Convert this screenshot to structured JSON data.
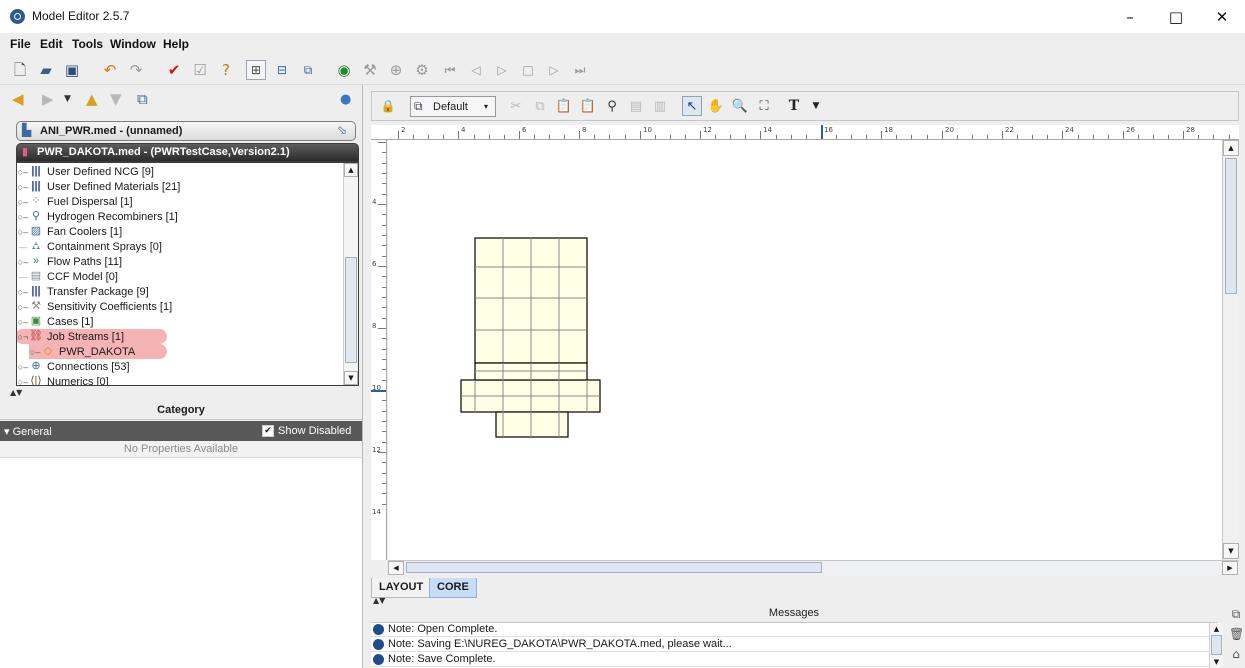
{
  "window": {
    "title": "Model Editor 2.5.7",
    "minimize": "–",
    "maximize": "□",
    "close": "✕"
  },
  "menu": [
    "File",
    "Edit",
    "Tools",
    "Window",
    "Help"
  ],
  "toolbar_icons": [
    "new-file-icon",
    "open-folder-icon",
    "save-icon",
    "undo-icon",
    "redo-icon",
    "check-icon",
    "run-check-icon",
    "help-icon",
    "layout-view-icon",
    "table-view-icon",
    "tree-view-icon",
    "run-icon",
    "wrench-icon",
    "target-icon",
    "settings-icon",
    "skip-start-icon",
    "step-back-icon",
    "play-icon",
    "stop-icon",
    "step-forward-icon",
    "skip-end-icon"
  ],
  "model": {
    "title": "ANI_PWR.med - (unnamed)"
  },
  "doc": {
    "title": "PWR_DAKOTA.med - (PWRTestCase,Version2.1)"
  },
  "tree": [
    {
      "label": "User Defined NCG [9]"
    },
    {
      "label": "User Defined Materials [21]"
    },
    {
      "label": "Fuel Dispersal [1]"
    },
    {
      "label": "Hydrogen Recombiners [1]"
    },
    {
      "label": "Fan Coolers [1]"
    },
    {
      "label": "Containment Sprays [0]"
    },
    {
      "label": "Flow Paths [11]"
    },
    {
      "label": "CCF Model [0]"
    },
    {
      "label": "Transfer Package [9]"
    },
    {
      "label": "Sensitivity Coefficients [1]"
    },
    {
      "label": "Cases [1]"
    },
    {
      "label": "Job Streams [1]"
    },
    {
      "label": "PWR_DAKOTA"
    },
    {
      "label": "Connections [53]"
    },
    {
      "label": "Numerics [0]"
    }
  ],
  "properties": {
    "category": "Category",
    "general": "General",
    "show_disabled": "Show Disabled",
    "show_disabled_checked": true,
    "empty": "No Properties Available"
  },
  "layout": {
    "combo": "Default",
    "ruler_x": [
      "2",
      "4",
      "6",
      "8",
      "10",
      "12",
      "14",
      "16",
      "18",
      "20",
      "22",
      "24",
      "26",
      "28"
    ],
    "ruler_y": [
      "4",
      "6",
      "8",
      "10",
      "12",
      "14"
    ],
    "tabs": [
      "LAYOUT",
      "CORE"
    ],
    "active_tab": "CORE"
  },
  "messages": {
    "header": "Messages",
    "items": [
      "Note: Open Complete.",
      "Note: Saving E:\\NUREG_DAKOTA\\PWR_DAKOTA.med, please wait...",
      "Note: Save Complete."
    ]
  },
  "colors": {
    "accent": "#3a75c4",
    "highlight": "#f5b3b3",
    "grid_fill": "#ffffe6"
  }
}
